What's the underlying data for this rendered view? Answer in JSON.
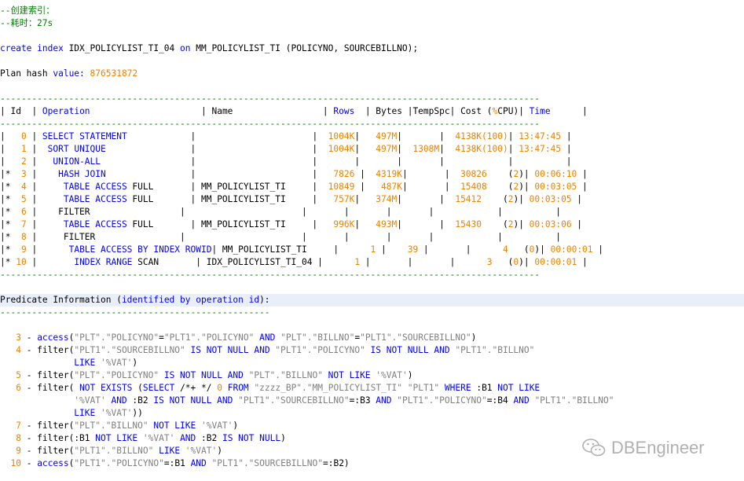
{
  "header": {
    "comment1": "--创建索引：",
    "comment2": "--耗时：27s",
    "create_kw": "create index",
    "index_name": " IDX_POLICYLIST_TI_04 ",
    "on_kw": "on",
    "table_clause": " MM_POLICYLIST_TI (POLICYNO, SOURCEBILLNO);",
    "plan_hash_label": "Plan hash ",
    "value_kw": "value:",
    "plan_hash_value": "876531872"
  },
  "plan": {
    "separator": "------------------------------------------------------------------------------------------------------",
    "header_row": [
      {
        "t": "| ",
        "c": "txt"
      },
      {
        "t": "Id",
        "c": "txt"
      },
      {
        "t": "  | ",
        "c": "txt"
      },
      {
        "t": "Operation",
        "c": "kw"
      },
      {
        "t": "                     | ",
        "c": "txt"
      },
      {
        "t": "Name",
        "c": "txt"
      },
      {
        "t": "                 | ",
        "c": "txt"
      },
      {
        "t": "Rows",
        "c": "kw"
      },
      {
        "t": "  | Bytes |TempSpc| Cost (",
        "c": "txt"
      },
      {
        "t": "%",
        "c": "num"
      },
      {
        "t": "CPU)",
        "c": "txt"
      },
      {
        "t": "| ",
        "c": "txt"
      },
      {
        "t": "Time",
        "c": "kw"
      },
      {
        "t": "      |",
        "c": "txt"
      }
    ],
    "rows": [
      [
        {
          "t": "|   ",
          "c": "txt"
        },
        {
          "t": "0",
          "c": "num"
        },
        {
          "t": " | ",
          "c": "txt"
        },
        {
          "t": "SELECT STATEMENT",
          "c": "kw"
        },
        {
          "t": "            |                      |  ",
          "c": "txt"
        },
        {
          "t": "1004K",
          "c": "num"
        },
        {
          "t": "|   ",
          "c": "txt"
        },
        {
          "t": "497M",
          "c": "num"
        },
        {
          "t": "|       |  ",
          "c": "txt"
        },
        {
          "t": "4138K(100)",
          "c": "num"
        },
        {
          "t": "| ",
          "c": "txt"
        },
        {
          "t": "13:47:45",
          "c": "num"
        },
        {
          "t": " |",
          "c": "txt"
        }
      ],
      [
        {
          "t": "|   ",
          "c": "txt"
        },
        {
          "t": "1",
          "c": "num"
        },
        {
          "t": " |  ",
          "c": "txt"
        },
        {
          "t": "SORT UNIQUE",
          "c": "kw"
        },
        {
          "t": "                |                      |  ",
          "c": "txt"
        },
        {
          "t": "1004K",
          "c": "num"
        },
        {
          "t": "|   ",
          "c": "txt"
        },
        {
          "t": "497M",
          "c": "num"
        },
        {
          "t": "|  ",
          "c": "txt"
        },
        {
          "t": "1308M",
          "c": "num"
        },
        {
          "t": "|  ",
          "c": "txt"
        },
        {
          "t": "4138K(100)",
          "c": "num"
        },
        {
          "t": "| ",
          "c": "txt"
        },
        {
          "t": "13:47:45",
          "c": "num"
        },
        {
          "t": " |",
          "c": "txt"
        }
      ],
      [
        {
          "t": "|   ",
          "c": "txt"
        },
        {
          "t": "2",
          "c": "num"
        },
        {
          "t": " |   ",
          "c": "txt"
        },
        {
          "t": "UNION-ALL",
          "c": "kw"
        },
        {
          "t": "                 |                      |       |       |       |            |          |",
          "c": "txt"
        }
      ],
      [
        {
          "t": "|* ",
          "c": "txt"
        },
        {
          "t": " 3",
          "c": "num"
        },
        {
          "t": " |    ",
          "c": "txt"
        },
        {
          "t": "HASH JOIN",
          "c": "kw"
        },
        {
          "t": "                |                      |   ",
          "c": "txt"
        },
        {
          "t": "7826",
          "c": "num"
        },
        {
          "t": " |  ",
          "c": "txt"
        },
        {
          "t": "4319K",
          "c": "num"
        },
        {
          "t": "|       |  ",
          "c": "txt"
        },
        {
          "t": "30826",
          "c": "num"
        },
        {
          "t": "    (",
          "c": "txt"
        },
        {
          "t": "2",
          "c": "num"
        },
        {
          "t": ")| ",
          "c": "txt"
        },
        {
          "t": "00:06:10",
          "c": "num"
        },
        {
          "t": " |",
          "c": "txt"
        }
      ],
      [
        {
          "t": "|* ",
          "c": "txt"
        },
        {
          "t": " 4",
          "c": "num"
        },
        {
          "t": " |     ",
          "c": "txt"
        },
        {
          "t": "TABLE ACCESS",
          "c": "kw"
        },
        {
          "t": " FULL       | MM_POLICYLIST_TI     |  ",
          "c": "txt"
        },
        {
          "t": "10849",
          "c": "num"
        },
        {
          "t": " |   ",
          "c": "txt"
        },
        {
          "t": "487K",
          "c": "num"
        },
        {
          "t": "|       |  ",
          "c": "txt"
        },
        {
          "t": "15408",
          "c": "num"
        },
        {
          "t": "    (",
          "c": "txt"
        },
        {
          "t": "2",
          "c": "num"
        },
        {
          "t": ")| ",
          "c": "txt"
        },
        {
          "t": "00:03:05",
          "c": "num"
        },
        {
          "t": " |",
          "c": "txt"
        }
      ],
      [
        {
          "t": "|* ",
          "c": "txt"
        },
        {
          "t": " 5",
          "c": "num"
        },
        {
          "t": " |     ",
          "c": "txt"
        },
        {
          "t": "TABLE ACCESS",
          "c": "kw"
        },
        {
          "t": " FULL       | MM_POLICYLIST_TI     |   ",
          "c": "txt"
        },
        {
          "t": "757K",
          "c": "num"
        },
        {
          "t": "|   ",
          "c": "txt"
        },
        {
          "t": "374M",
          "c": "num"
        },
        {
          "t": "|       |  ",
          "c": "txt"
        },
        {
          "t": "15412",
          "c": "num"
        },
        {
          "t": "    (",
          "c": "txt"
        },
        {
          "t": "2",
          "c": "num"
        },
        {
          "t": ")| ",
          "c": "txt"
        },
        {
          "t": "00:03:05",
          "c": "num"
        },
        {
          "t": " |",
          "c": "txt"
        }
      ],
      [
        {
          "t": "|* ",
          "c": "txt"
        },
        {
          "t": " 6",
          "c": "num"
        },
        {
          "t": " |    FILTER                 |                      |       |       |       |            |          |",
          "c": "txt"
        }
      ],
      [
        {
          "t": "|* ",
          "c": "txt"
        },
        {
          "t": " 7",
          "c": "num"
        },
        {
          "t": " |     ",
          "c": "txt"
        },
        {
          "t": "TABLE ACCESS",
          "c": "kw"
        },
        {
          "t": " FULL       | MM_POLICYLIST_TI     |   ",
          "c": "txt"
        },
        {
          "t": "996K",
          "c": "num"
        },
        {
          "t": "|   ",
          "c": "txt"
        },
        {
          "t": "493M",
          "c": "num"
        },
        {
          "t": "|       |  ",
          "c": "txt"
        },
        {
          "t": "15430",
          "c": "num"
        },
        {
          "t": "    (",
          "c": "txt"
        },
        {
          "t": "2",
          "c": "num"
        },
        {
          "t": ")| ",
          "c": "txt"
        },
        {
          "t": "00:03:06",
          "c": "num"
        },
        {
          "t": " |",
          "c": "txt"
        }
      ],
      [
        {
          "t": "|* ",
          "c": "txt"
        },
        {
          "t": " 8",
          "c": "num"
        },
        {
          "t": " |     FILTER                |                      |       |       |       |            |          |",
          "c": "txt"
        }
      ],
      [
        {
          "t": "|* ",
          "c": "txt"
        },
        {
          "t": " 9",
          "c": "num"
        },
        {
          "t": " |      ",
          "c": "txt"
        },
        {
          "t": "TABLE ACCESS BY INDEX ROWID",
          "c": "kw"
        },
        {
          "t": "| MM_POLICYLIST_TI     |      ",
          "c": "txt"
        },
        {
          "t": "1",
          "c": "num"
        },
        {
          "t": " |    ",
          "c": "txt"
        },
        {
          "t": "39",
          "c": "num"
        },
        {
          "t": " |       |      ",
          "c": "txt"
        },
        {
          "t": "4",
          "c": "num"
        },
        {
          "t": "   (",
          "c": "txt"
        },
        {
          "t": "0",
          "c": "num"
        },
        {
          "t": ")| ",
          "c": "txt"
        },
        {
          "t": "00:00:01",
          "c": "num"
        },
        {
          "t": " |",
          "c": "txt"
        }
      ],
      [
        {
          "t": "|* ",
          "c": "txt"
        },
        {
          "t": "10",
          "c": "num"
        },
        {
          "t": " |       ",
          "c": "txt"
        },
        {
          "t": "INDEX RANGE",
          "c": "kw"
        },
        {
          "t": " SCAN       | IDX_POLICYLIST_TI_04 |      ",
          "c": "txt"
        },
        {
          "t": "1",
          "c": "num"
        },
        {
          "t": " |       |       |      ",
          "c": "txt"
        },
        {
          "t": "3",
          "c": "num"
        },
        {
          "t": "   (",
          "c": "txt"
        },
        {
          "t": "0",
          "c": "num"
        },
        {
          "t": ")| ",
          "c": "txt"
        },
        {
          "t": "00:00:01",
          "c": "num"
        },
        {
          "t": " |",
          "c": "txt"
        }
      ]
    ]
  },
  "predicate": {
    "title": [
      {
        "t": "Predicate Information ",
        "c": "txt"
      },
      {
        "t": "(",
        "c": "txt"
      },
      {
        "t": "identified by operation id",
        "c": "kw"
      },
      {
        "t": "):",
        "c": "txt"
      }
    ],
    "underline": "---------------------------------------------------",
    "lines": [
      [
        {
          "t": "   ",
          "c": "txt"
        },
        {
          "t": "3",
          "c": "num"
        },
        {
          "t": " - ",
          "c": "txt"
        },
        {
          "t": "access",
          "c": "kw"
        },
        {
          "t": "(",
          "c": "txt"
        },
        {
          "t": "\"PLT\".\"POLICYNO\"",
          "c": "str"
        },
        {
          "t": "=",
          "c": "txt"
        },
        {
          "t": "\"PLT1\".\"POLICYNO\"",
          "c": "str"
        },
        {
          "t": " AND ",
          "c": "kw"
        },
        {
          "t": "\"PLT\".\"BILLNO\"",
          "c": "str"
        },
        {
          "t": "=",
          "c": "txt"
        },
        {
          "t": "\"PLT1\".\"SOURCEBILLNO\"",
          "c": "str"
        },
        {
          "t": ")",
          "c": "txt"
        }
      ],
      [
        {
          "t": "   ",
          "c": "txt"
        },
        {
          "t": "4",
          "c": "num"
        },
        {
          "t": " - filter(",
          "c": "txt"
        },
        {
          "t": "\"PLT1\".\"SOURCEBILLNO\"",
          "c": "str"
        },
        {
          "t": " IS NOT NULL AND ",
          "c": "kw"
        },
        {
          "t": "\"PLT1\".\"POLICYNO\"",
          "c": "str"
        },
        {
          "t": " IS NOT NULL AND ",
          "c": "kw"
        },
        {
          "t": "\"PLT1\".\"BILLNO\"",
          "c": "str"
        }
      ],
      [
        {
          "t": "              ",
          "c": "txt"
        },
        {
          "t": "LIKE",
          "c": "kw"
        },
        {
          "t": " ",
          "c": "txt"
        },
        {
          "t": "'%VAT'",
          "c": "str"
        },
        {
          "t": ")",
          "c": "txt"
        }
      ],
      [
        {
          "t": "   ",
          "c": "txt"
        },
        {
          "t": "5",
          "c": "num"
        },
        {
          "t": " - filter(",
          "c": "txt"
        },
        {
          "t": "\"PLT\".\"POLICYNO\"",
          "c": "str"
        },
        {
          "t": " IS NOT NULL AND ",
          "c": "kw"
        },
        {
          "t": "\"PLT\".\"BILLNO\"",
          "c": "str"
        },
        {
          "t": " NOT LIKE ",
          "c": "kw"
        },
        {
          "t": "'%VAT'",
          "c": "str"
        },
        {
          "t": ")",
          "c": "txt"
        }
      ],
      [
        {
          "t": "   ",
          "c": "txt"
        },
        {
          "t": "6",
          "c": "num"
        },
        {
          "t": " - filter( ",
          "c": "txt"
        },
        {
          "t": "NOT EXISTS",
          "c": "kw"
        },
        {
          "t": " (",
          "c": "txt"
        },
        {
          "t": "SELECT",
          "c": "kw"
        },
        {
          "t": " /*+ */ ",
          "c": "txt"
        },
        {
          "t": "0",
          "c": "num"
        },
        {
          "t": " ",
          "c": "txt"
        },
        {
          "t": "FROM",
          "c": "kw"
        },
        {
          "t": " ",
          "c": "txt"
        },
        {
          "t": "\"zzzz_BP\".\"MM_POLICYLIST_TI\" \"PLT1\"",
          "c": "str"
        },
        {
          "t": " WHERE",
          "c": "kw"
        },
        {
          "t": " :B1 ",
          "c": "txt"
        },
        {
          "t": "NOT LIKE",
          "c": "kw"
        }
      ],
      [
        {
          "t": "              ",
          "c": "txt"
        },
        {
          "t": "'%VAT'",
          "c": "str"
        },
        {
          "t": " AND",
          "c": "kw"
        },
        {
          "t": " :B2 ",
          "c": "txt"
        },
        {
          "t": "IS NOT NULL AND",
          "c": "kw"
        },
        {
          "t": " ",
          "c": "txt"
        },
        {
          "t": "\"PLT1\".\"SOURCEBILLNO\"",
          "c": "str"
        },
        {
          "t": "=:B3 ",
          "c": "txt"
        },
        {
          "t": "AND",
          "c": "kw"
        },
        {
          "t": " ",
          "c": "txt"
        },
        {
          "t": "\"PLT1\".\"POLICYNO\"",
          "c": "str"
        },
        {
          "t": "=:B4 ",
          "c": "txt"
        },
        {
          "t": "AND",
          "c": "kw"
        },
        {
          "t": " ",
          "c": "txt"
        },
        {
          "t": "\"PLT1\".\"BILLNO\"",
          "c": "str"
        }
      ],
      [
        {
          "t": "              ",
          "c": "txt"
        },
        {
          "t": "LIKE",
          "c": "kw"
        },
        {
          "t": " ",
          "c": "txt"
        },
        {
          "t": "'%VAT'",
          "c": "str"
        },
        {
          "t": "))",
          "c": "txt"
        }
      ],
      [
        {
          "t": "   ",
          "c": "txt"
        },
        {
          "t": "7",
          "c": "num"
        },
        {
          "t": " - filter(",
          "c": "txt"
        },
        {
          "t": "\"PLT\".\"BILLNO\"",
          "c": "str"
        },
        {
          "t": " NOT LIKE ",
          "c": "kw"
        },
        {
          "t": "'%VAT'",
          "c": "str"
        },
        {
          "t": ")",
          "c": "txt"
        }
      ],
      [
        {
          "t": "   ",
          "c": "txt"
        },
        {
          "t": "8",
          "c": "num"
        },
        {
          "t": " - filter(:B1 ",
          "c": "txt"
        },
        {
          "t": "NOT LIKE",
          "c": "kw"
        },
        {
          "t": " ",
          "c": "txt"
        },
        {
          "t": "'%VAT'",
          "c": "str"
        },
        {
          "t": " AND",
          "c": "kw"
        },
        {
          "t": " :B2 ",
          "c": "txt"
        },
        {
          "t": "IS NOT NULL",
          "c": "kw"
        },
        {
          "t": ")",
          "c": "txt"
        }
      ],
      [
        {
          "t": "   ",
          "c": "txt"
        },
        {
          "t": "9",
          "c": "num"
        },
        {
          "t": " - filter(",
          "c": "txt"
        },
        {
          "t": "\"PLT1\".\"BILLNO\"",
          "c": "str"
        },
        {
          "t": " LIKE ",
          "c": "kw"
        },
        {
          "t": "'%VAT'",
          "c": "str"
        },
        {
          "t": ")",
          "c": "txt"
        }
      ],
      [
        {
          "t": "  ",
          "c": "txt"
        },
        {
          "t": "10",
          "c": "num"
        },
        {
          "t": " - ",
          "c": "txt"
        },
        {
          "t": "access",
          "c": "kw"
        },
        {
          "t": "(",
          "c": "txt"
        },
        {
          "t": "\"PLT1\".\"POLICYNO\"",
          "c": "str"
        },
        {
          "t": "=:B1 ",
          "c": "txt"
        },
        {
          "t": "AND",
          "c": "kw"
        },
        {
          "t": " ",
          "c": "txt"
        },
        {
          "t": "\"PLT1\".\"SOURCEBILLNO\"",
          "c": "str"
        },
        {
          "t": "=:B2)",
          "c": "txt"
        }
      ]
    ]
  },
  "watermark": {
    "text": "DBEngineer",
    "icon": "wechat-icon"
  },
  "colors": {
    "comment": "#008000",
    "keyword": "#0000ff",
    "number": "#f08000",
    "string": "#808080",
    "highlight": "#e8eefa"
  }
}
